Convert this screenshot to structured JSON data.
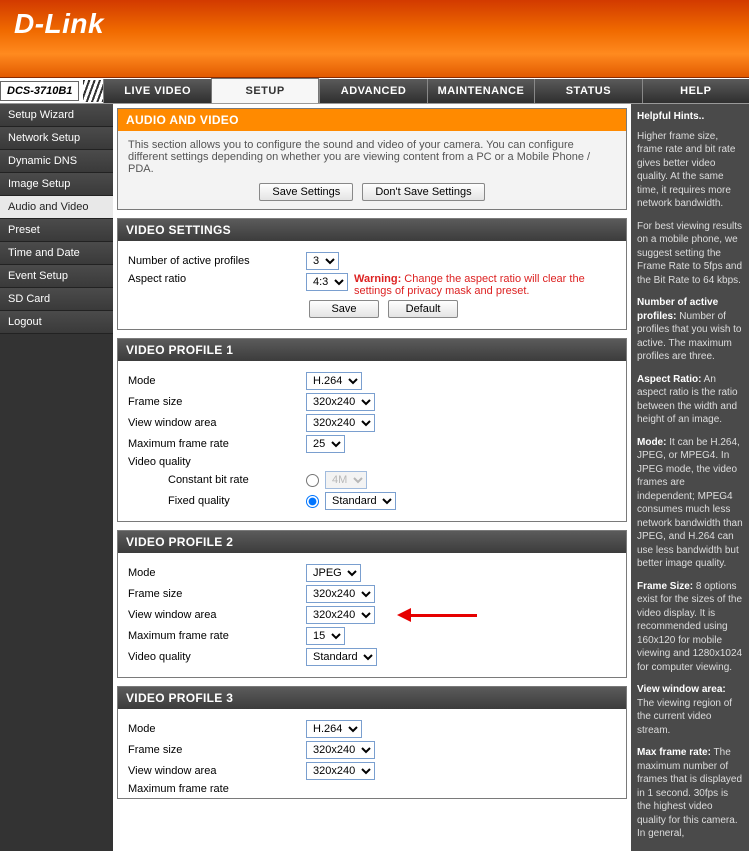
{
  "brand": "D-Link",
  "device": "DCS-3710B1",
  "tabs": {
    "live": "LIVE VIDEO",
    "setup": "SETUP",
    "advanced": "ADVANCED",
    "maintenance": "MAINTENANCE",
    "status": "STATUS",
    "help": "HELP"
  },
  "sidebar": {
    "items": [
      "Setup Wizard",
      "Network Setup",
      "Dynamic DNS",
      "Image Setup",
      "Audio and Video",
      "Preset",
      "Time and Date",
      "Event Setup",
      "SD Card",
      "Logout"
    ]
  },
  "panel": {
    "title": "AUDIO AND VIDEO",
    "desc": "This section allows you to configure the sound and video of your camera. You can configure different settings depending on whether you are viewing content from a PC or a Mobile Phone / PDA.",
    "save": "Save Settings",
    "dont": "Don't Save Settings"
  },
  "settings": {
    "title": "VIDEO SETTINGS",
    "nprof_lbl": "Number of active profiles",
    "nprof_val": "3",
    "aspect_lbl": "Aspect ratio",
    "aspect_val": "4:3",
    "warning_lbl": "Warning:",
    "warning_msg": " Change the aspect ratio will clear the settings of privacy mask and preset.",
    "save_btn": "Save",
    "default_btn": "Default"
  },
  "labels": {
    "mode": "Mode",
    "frame_size": "Frame size",
    "view_window": "View window area",
    "max_rate": "Maximum frame rate",
    "vquality": "Video quality",
    "cbr": "Constant bit rate",
    "fq": "Fixed quality",
    "cbr_val": "4M",
    "std": "Standard"
  },
  "vp1": {
    "title": "VIDEO PROFILE 1",
    "mode": "H.264",
    "fsize": "320x240",
    "vwin": "320x240",
    "rate": "25"
  },
  "vp2": {
    "title": "VIDEO PROFILE 2",
    "mode": "JPEG",
    "fsize": "320x240",
    "vwin": "320x240",
    "rate": "15",
    "vq": "Standard"
  },
  "vp3": {
    "title": "VIDEO PROFILE 3",
    "mode": "H.264",
    "fsize": "320x240",
    "vwin": "320x240"
  },
  "hints": {
    "title": "Helpful Hints..",
    "p1": "Higher frame size, frame rate and bit rate gives better video quality. At the same time, it requires more network bandwidth.",
    "p2": "For best viewing results on a mobile phone, we suggest setting the Frame Rate to 5fps and the Bit Rate to 64 kbps.",
    "p3_lbl": "Number of active profiles:",
    "p3": " Number of profiles that you wish to active. The maximum profiles are three.",
    "p4_lbl": "Aspect Ratio:",
    "p4": " An aspect ratio is the ratio between the width and height of an image.",
    "p5_lbl": "Mode:",
    "p5": " It can be H.264, JPEG, or MPEG4. In JPEG mode, the video frames are independent; MPEG4 consumes much less network bandwidth than JPEG, and H.264 can use less bandwidth but better image quality.",
    "p6_lbl": "Frame Size:",
    "p6": " 8 options exist for the sizes of the video display. It is recommended using 160x120 for mobile viewing and 1280x1024 for computer viewing.",
    "p7_lbl": "View window area:",
    "p7": " The viewing region of the current video stream.",
    "p8_lbl": "Max frame rate:",
    "p8": " The maximum number of frames that is displayed in 1 second. 30fps is the highest video quality for this camera. In general,"
  }
}
